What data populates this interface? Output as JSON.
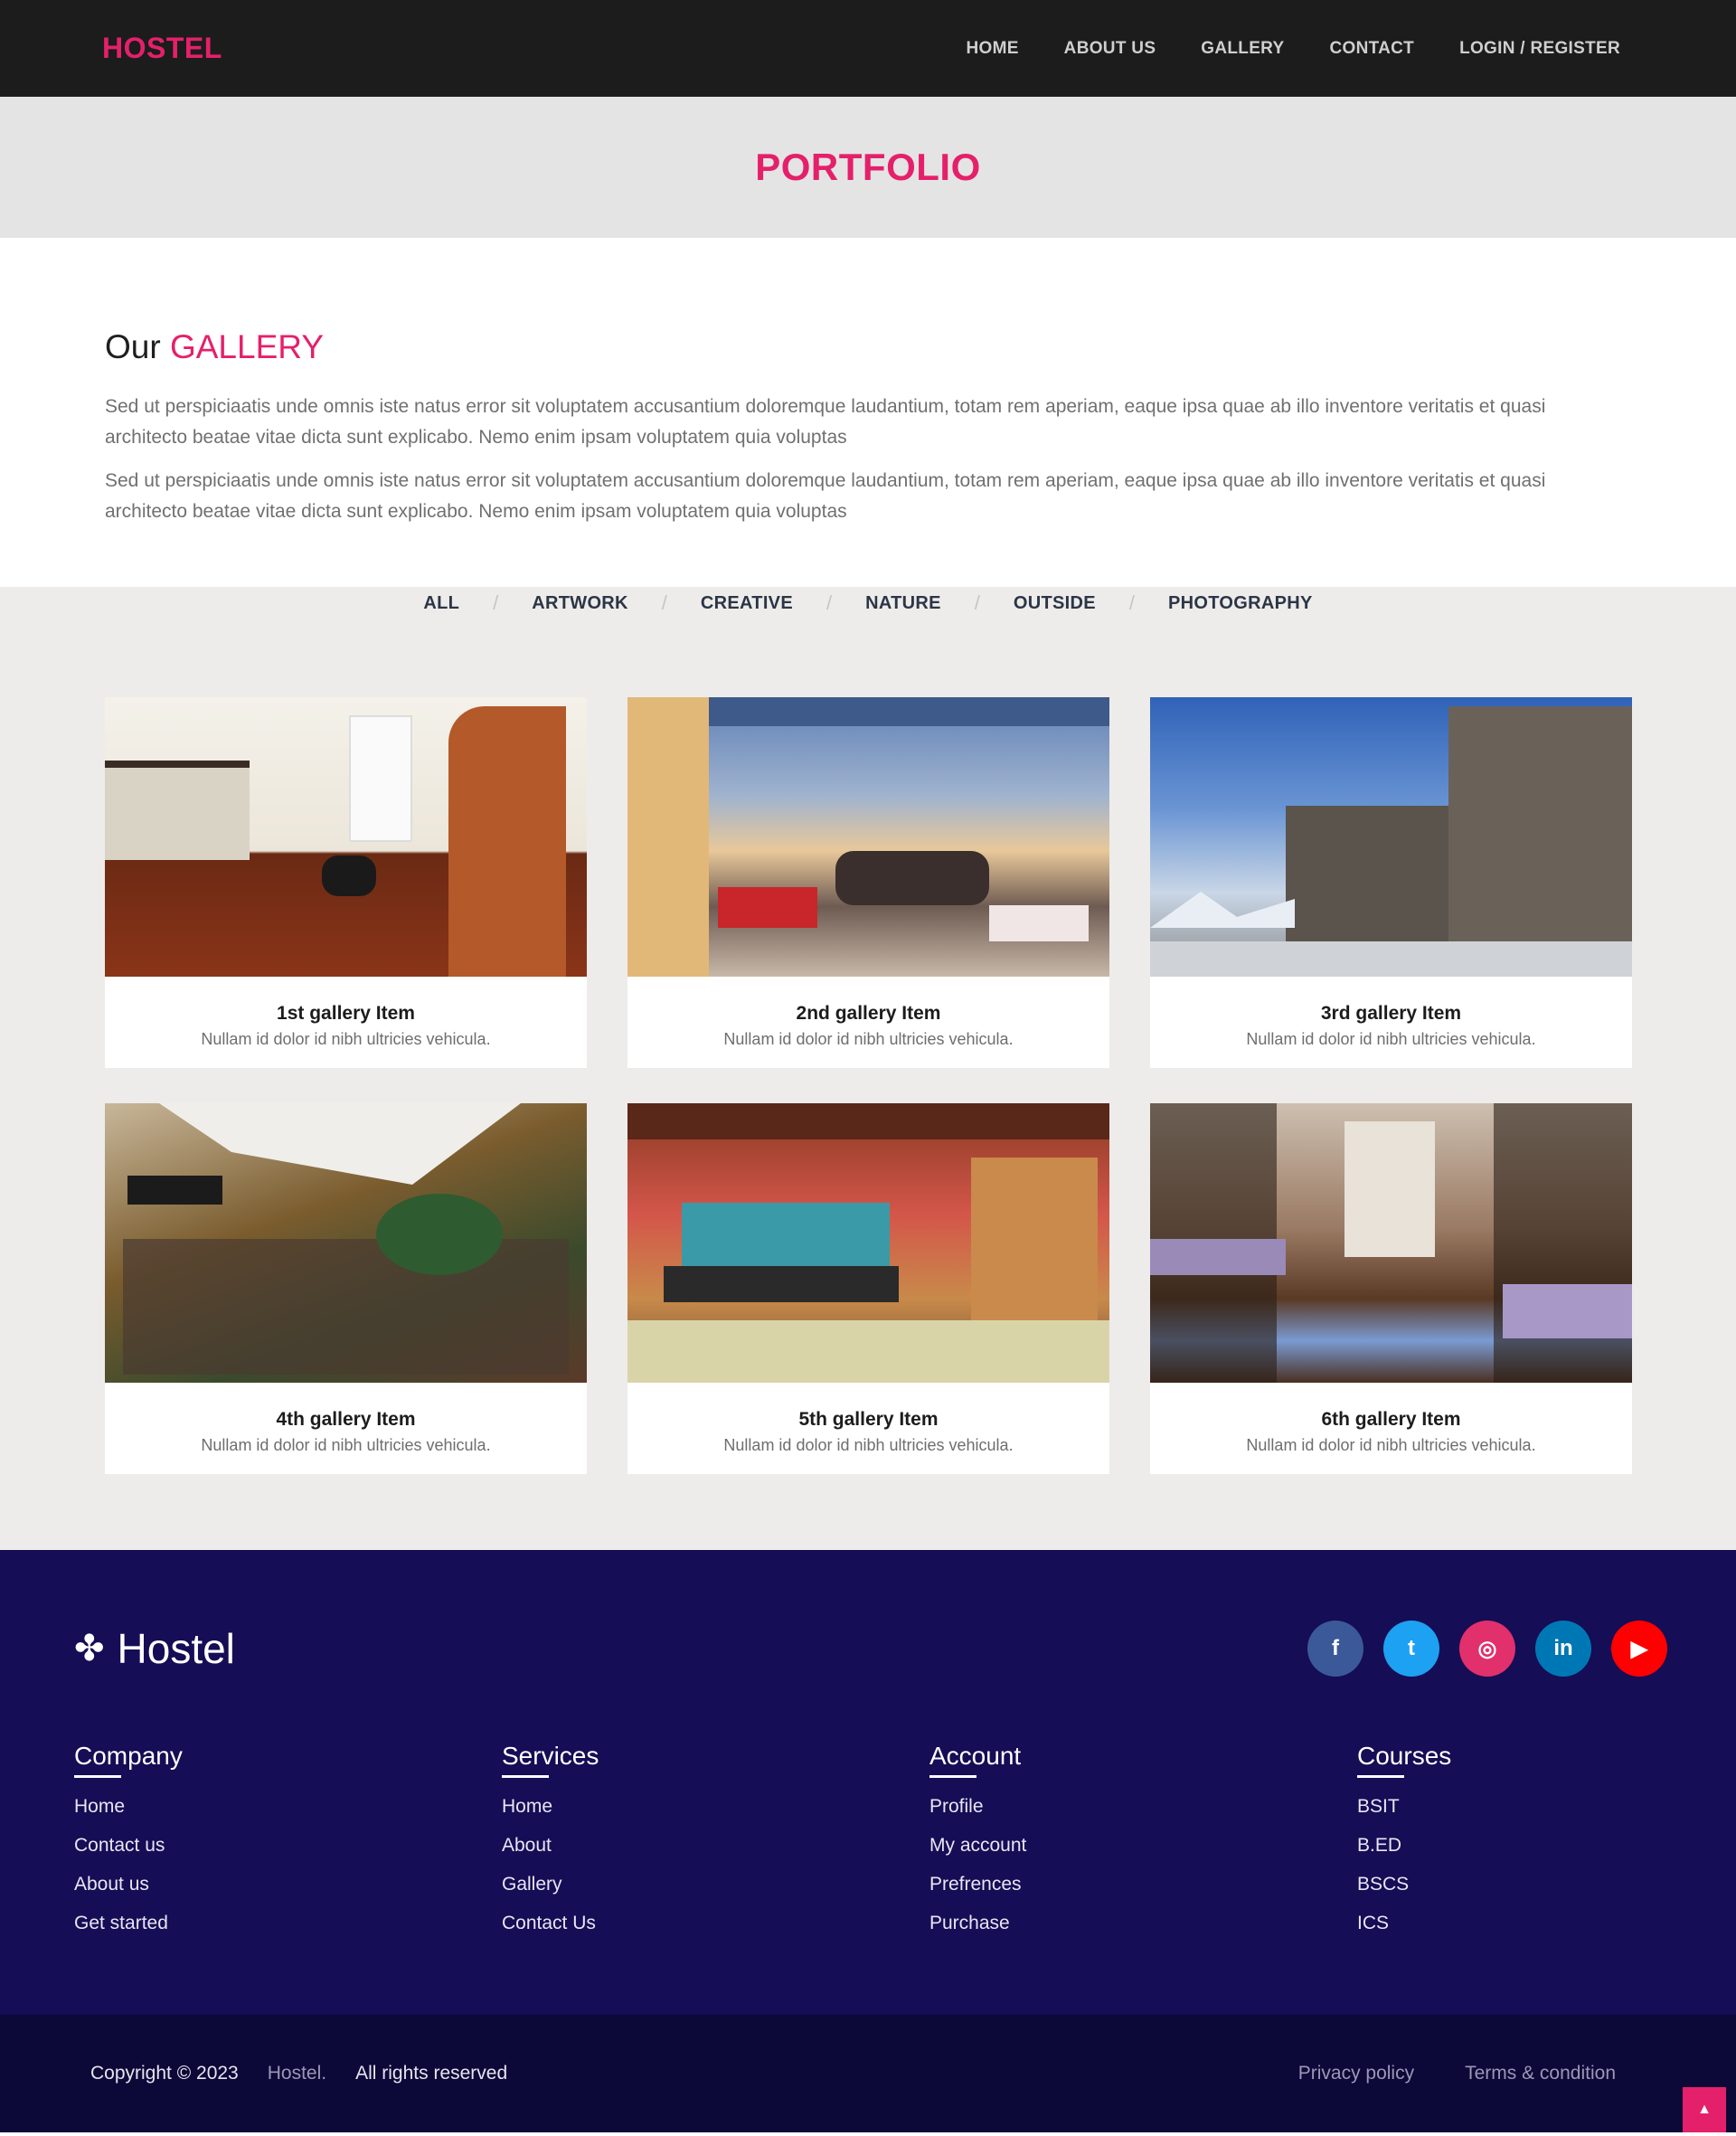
{
  "nav": {
    "brand": "HOSTEL",
    "links": [
      "HOME",
      "ABOUT US",
      "GALLERY",
      "CONTACT",
      "LOGIN / REGISTER"
    ]
  },
  "banner": {
    "title": "PORTFOLIO"
  },
  "intro": {
    "title_prefix": "Our",
    "title_accent": "GALLERY",
    "paragraphs": [
      "Sed ut perspiciaatis unde omnis iste natus error sit voluptatem accusantium doloremque laudantium, totam rem aperiam, eaque ipsa quae ab illo inventore veritatis et quasi architecto beatae vitae dicta sunt explicabo. Nemo enim ipsam voluptatem quia voluptas",
      "Sed ut perspiciaatis unde omnis iste natus error sit voluptatem accusantium doloremque laudantium, totam rem aperiam, eaque ipsa quae ab illo inventore veritatis et quasi architecto beatae vitae dicta sunt explicabo. Nemo enim ipsam voluptatem quia voluptas"
    ]
  },
  "filters": [
    "ALL",
    "ARTWORK",
    "CREATIVE",
    "NATURE",
    "OUTSIDE",
    "PHOTOGRAPHY"
  ],
  "gallery": [
    {
      "title": "1st gallery Item",
      "desc": "Nullam id dolor id nibh ultricies vehicula."
    },
    {
      "title": "2nd gallery Item",
      "desc": "Nullam id dolor id nibh ultricies vehicula."
    },
    {
      "title": "3rd gallery Item",
      "desc": "Nullam id dolor id nibh ultricies vehicula."
    },
    {
      "title": "4th gallery Item",
      "desc": "Nullam id dolor id nibh ultricies vehicula."
    },
    {
      "title": "5th gallery Item",
      "desc": "Nullam id dolor id nibh ultricies vehicula."
    },
    {
      "title": "6th gallery Item",
      "desc": "Nullam id dolor id nibh ultricies vehicula."
    }
  ],
  "footer": {
    "brand": "Hostel",
    "socials": [
      {
        "name": "facebook-icon",
        "glyph": "f",
        "color": "#3b5998"
      },
      {
        "name": "twitter-icon",
        "glyph": "t",
        "color": "#1da1f2"
      },
      {
        "name": "instagram-icon",
        "glyph": "◎",
        "color": "#e1306c"
      },
      {
        "name": "linkedin-icon",
        "glyph": "in",
        "color": "#0077b5"
      },
      {
        "name": "youtube-icon",
        "glyph": "▶",
        "color": "#ff0000"
      }
    ],
    "columns": [
      {
        "heading": "Company",
        "items": [
          "Home",
          "Contact us",
          "About us",
          "Get started"
        ]
      },
      {
        "heading": "Services",
        "items": [
          "Home",
          "About",
          "Gallery",
          "Contact Us"
        ]
      },
      {
        "heading": "Account",
        "items": [
          "Profile",
          "My account",
          "Prefrences",
          "Purchase"
        ]
      },
      {
        "heading": "Courses",
        "items": [
          "BSIT",
          "B.ED",
          "BSCS",
          "ICS"
        ]
      }
    ],
    "copyright": "Copyright © 2023",
    "copyright_brand": "Hostel.",
    "rights": "All rights reserved",
    "privacy": "Privacy policy",
    "terms": "Terms & condition"
  },
  "colors": {
    "accent": "#e5206a",
    "footer_bg": "#150d55",
    "footer_bottom": "#0c0838"
  }
}
